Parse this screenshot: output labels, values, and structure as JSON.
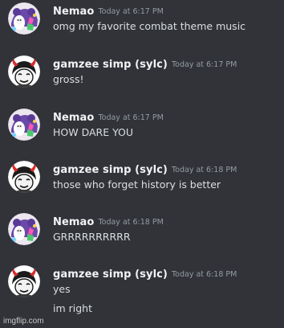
{
  "app": "Discord",
  "users": {
    "nemao": {
      "name": "Nemao",
      "avatar_icon": "nemao-avatar-icon"
    },
    "gamzee": {
      "name": "gamzee simp (sylc)",
      "avatar_icon": "gamzee-avatar-icon"
    }
  },
  "messages": [
    {
      "author": "Nemao",
      "timestamp": "Today at 6:17 PM",
      "lines": [
        "omg my favorite combat theme music"
      ]
    },
    {
      "author": "gamzee simp (sylc)",
      "timestamp": "Today at 6:17 PM",
      "lines": [
        "gross!"
      ]
    },
    {
      "author": "Nemao",
      "timestamp": "Today at 6:17 PM",
      "lines": [
        "HOW DARE YOU"
      ]
    },
    {
      "author": "gamzee simp (sylc)",
      "timestamp": "Today at 6:18 PM",
      "lines": [
        "those who forget history is better"
      ]
    },
    {
      "author": "Nemao",
      "timestamp": "Today at 6:18 PM",
      "lines": [
        "GRRRRRRRRRR"
      ]
    },
    {
      "author": "gamzee simp (sylc)",
      "timestamp": "Today at 6:18 PM",
      "lines": [
        "yes",
        "im right"
      ]
    }
  ],
  "watermark": "imgflip.com",
  "colors": {
    "background": "#313338",
    "username": "#f2f3f5",
    "timestamp": "#949ba4",
    "message_text": "#dbdee1"
  }
}
